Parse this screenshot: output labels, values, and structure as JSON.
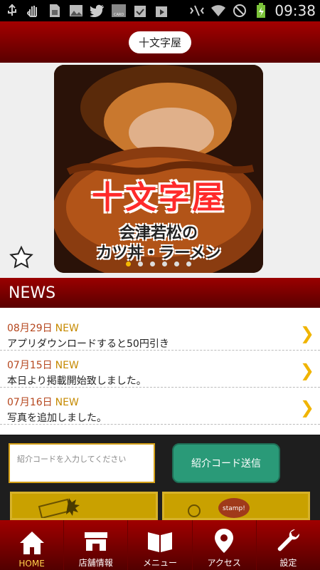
{
  "statusbar": {
    "time": "09:38"
  },
  "header": {
    "store_name": "十文字屋"
  },
  "hero": {
    "title": "十文字屋",
    "subtitle_line1": "会津若松の",
    "subtitle_line2": "カツ丼・ラーメン",
    "slide_count": 6,
    "active_slide": 0
  },
  "news": {
    "heading": "NEWS",
    "items": [
      {
        "date": "08月29日",
        "badge": "NEW",
        "text": "アプリダウンロードすると50円引き"
      },
      {
        "date": "07月15日",
        "badge": "NEW",
        "text": "本日より掲載開始致しました。"
      },
      {
        "date": "07月16日",
        "badge": "NEW",
        "text": "写真を追加しました。"
      }
    ]
  },
  "referral": {
    "placeholder": "紹介コードを入力してください",
    "button_label": "紹介コード送信"
  },
  "tabs": [
    {
      "label": "HOME",
      "icon": "home-icon",
      "active": true
    },
    {
      "label": "店舗情報",
      "icon": "store-icon",
      "active": false
    },
    {
      "label": "メニュー",
      "icon": "menu-book-icon",
      "active": false
    },
    {
      "label": "アクセス",
      "icon": "map-pin-icon",
      "active": false
    },
    {
      "label": "設定",
      "icon": "wrench-icon",
      "active": false
    }
  ],
  "colors": {
    "accent_red": "#a00000",
    "new_badge": "#c68a00",
    "date_text": "#b5461d",
    "button_green": "#2a9a78",
    "chevron": "#f0b400"
  }
}
